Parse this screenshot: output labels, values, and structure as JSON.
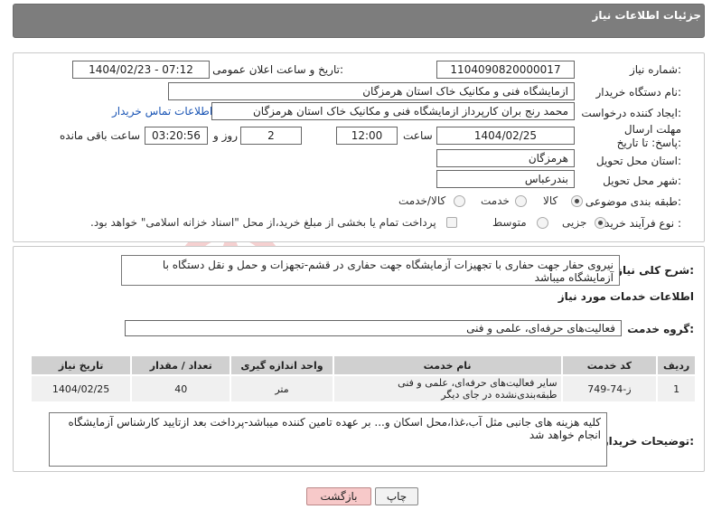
{
  "header": {
    "title": "جزئیات اطلاعات نیاز"
  },
  "form": {
    "need_number_label": "شماره نیاز:",
    "need_number": "1104090820000017",
    "announce_label": "تاریخ و ساعت اعلان عمومی:",
    "announce_value": "1404/02/23 - 07:12",
    "buyer_org_label": "نام دستگاه خریدار:",
    "buyer_org": "ازمایشگاه فنی و مکانیک خاک استان هرمزگان",
    "creator_label": "ایجاد کننده درخواست:",
    "creator": "محمد رنج بران کارپرداز ازمایشگاه فنی و مکانیک خاک استان هرمزگان",
    "contact_link": "اطلاعات تماس خریدار",
    "deadline_label": "مهلت ارسال پاسخ: تا تاریخ:",
    "deadline_date": "1404/02/25",
    "time_label": "ساعت",
    "deadline_time": "12:00",
    "days_value": "2",
    "days_label": "روز و",
    "remaining_value": "03:20:56",
    "remaining_label": "ساعت باقی مانده",
    "province_label": "استان محل تحویل:",
    "province": "هرمزگان",
    "city_label": "شهر محل تحویل:",
    "city": "بندرعباس",
    "category_label": "طبقه بندی موضوعی:",
    "category_options": [
      "کالا",
      "خدمت",
      "کالا/خدمت"
    ],
    "category_selected": "خدمت",
    "process_label": "نوع فرآیند خرید :",
    "process_options": [
      "جزیی",
      "متوسط"
    ],
    "process_selected": "جزیی",
    "payment_note": "پرداخت تمام یا بخشی از مبلغ خرید،از محل \"اسناد خزانه اسلامی\" خواهد بود."
  },
  "description": {
    "label": "شرح کلی نیاز:",
    "text": "نیروی حفار جهت حفاری با تجهیزات آزمایشگاه جهت حفاری در قشم-تجهزات و حمل و نقل دستگاه با آزمایشگاه میباشد"
  },
  "services": {
    "section_title": "اطلاعات خدمات مورد نیاز",
    "group_label": "گروه خدمت:",
    "group_value": "فعالیت‌های حرفه‌ای، علمی و فنی",
    "columns": [
      "ردیف",
      "کد خدمت",
      "نام خدمت",
      "واحد اندازه گیری",
      "تعداد / مقدار",
      "تاریخ نیاز"
    ],
    "rows": [
      {
        "idx": "1",
        "code": "ز-74-749",
        "name": "سایر فعالیت‌های حرفه‌ای، علمی و فنی طبقه‌بندی‌نشده در جای دیگر",
        "unit": "متر",
        "qty": "40",
        "date": "1404/02/25"
      }
    ]
  },
  "buyer_notes": {
    "label": "توضیحات خریدار:",
    "text": "کلیه هزینه های جانبی مثل آب،غذا،محل اسکان و... بر عهده تامین کننده میباشد-پرداخت بعد ازتایید کارشناس آزمایشگاه انجام خواهد شد"
  },
  "buttons": {
    "print": "چاپ",
    "back": "بازگشت"
  },
  "watermark": {
    "text": "AriaTender.neT"
  },
  "colors": {
    "header": "#7d7d7d",
    "link": "#1a55b5",
    "back_button": "#f7c9c9",
    "table_head": "#d0d0d0"
  }
}
